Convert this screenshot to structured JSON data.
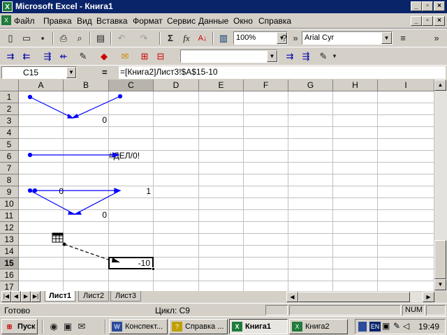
{
  "window": {
    "title": "Microsoft Excel - Книга1",
    "app_icon": "excel-icon",
    "controls": [
      "_",
      "▫",
      "×"
    ]
  },
  "menu": [
    "Файл",
    "Правка",
    "Вид",
    "Вставка",
    "Формат",
    "Сервис",
    "Данные",
    "Окно",
    "Справка"
  ],
  "toolbar": {
    "zoom": "100%",
    "font": "Arial Cyr",
    "sum_symbol": "Σ",
    "fx_symbol": "fx"
  },
  "formula_bar": {
    "cell_ref": "C15",
    "eq": "=",
    "formula": "=[Книга2]Лист3!$A$15-10"
  },
  "columns": [
    "A",
    "B",
    "C",
    "D",
    "E",
    "F",
    "G",
    "H",
    "I"
  ],
  "rows": [
    "1",
    "2",
    "3",
    "4",
    "5",
    "6",
    "7",
    "8",
    "9",
    "10",
    "11",
    "12",
    "13",
    "14",
    "15",
    "16",
    "17"
  ],
  "cells": {
    "b3": "0",
    "c6": "#ДЕЛ/0!",
    "b9": "0",
    "c9": "1",
    "b11": "0",
    "c15": "-10"
  },
  "sheets": [
    "Лист1",
    "Лист2",
    "Лист3"
  ],
  "status": {
    "ready": "Готово",
    "cycle": "Цикл: C9",
    "num": "NUM"
  },
  "taskbar": {
    "start": "Пуск",
    "tasks": [
      "Конспект...",
      "Справка ...",
      "Книга1",
      "Книга2"
    ],
    "lang": "EN",
    "clock": "19:49"
  }
}
